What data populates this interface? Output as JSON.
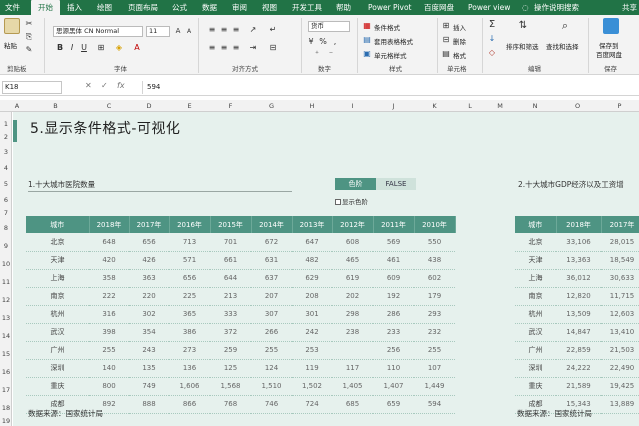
{
  "menu": {
    "tabs": [
      "文件",
      "开始",
      "插入",
      "绘图",
      "页面布局",
      "公式",
      "数据",
      "审阅",
      "视图",
      "开发工具",
      "帮助",
      "Power Pivot",
      "百度网盘",
      "Power view",
      "操作说明搜索",
      "共享"
    ]
  },
  "ribbon": {
    "clipboard": {
      "paste": "粘贴",
      "label": "剪贴板"
    },
    "font": {
      "name": "思源黑体 CN Normal",
      "size": "11",
      "label": "字体",
      "bold": "B",
      "italic": "I",
      "underline": "U",
      "grow": "A",
      "shrink": "A"
    },
    "align": {
      "label": "对齐方式"
    },
    "number": {
      "format": "货币",
      "label": "数字",
      "currency": "¥",
      "percent": "%",
      "comma": ","
    },
    "styles": {
      "cond": "条件格式",
      "table": "套用表格格式",
      "cell": "单元格样式",
      "label": "样式"
    },
    "cells": {
      "insert": "插入",
      "delete": "删除",
      "format": "格式",
      "label": "单元格"
    },
    "editing": {
      "sort": "排序和筛选",
      "find": "查找和选择",
      "label": "编辑"
    },
    "save": {
      "line1": "保存到",
      "line2": "百度网盘",
      "label": "保存"
    }
  },
  "formula": {
    "name": "K18",
    "fx": "fx",
    "value": "594"
  },
  "columns": [
    "A",
    "B",
    "C",
    "D",
    "E",
    "F",
    "G",
    "H",
    "I",
    "J",
    "K",
    "L",
    "M",
    "N",
    "O",
    "P"
  ],
  "rows": [
    "1",
    "2",
    "3",
    "4",
    "5",
    "6",
    "7",
    "8",
    "9",
    "10",
    "11",
    "12",
    "13",
    "14",
    "15",
    "16",
    "17",
    "18",
    "19"
  ],
  "sheet": {
    "title": "5.显示条件格式-可视化",
    "sub1": "1.十大城市医院数量",
    "sub2": "2.十大城市GDP经济以及工资增",
    "toggle_on": "色阶",
    "toggle_off": "FALSE",
    "checkbox": "显示色阶",
    "source1": "数据来源：国家统计局",
    "source2": "数据来源：国家统计局"
  },
  "table1": {
    "headers": [
      "城市",
      "2018年",
      "2017年",
      "2016年",
      "2015年",
      "2014年",
      "2013年",
      "2012年",
      "2011年",
      "2010年"
    ],
    "rows": [
      [
        "北京",
        "648",
        "656",
        "713",
        "701",
        "672",
        "647",
        "608",
        "569",
        "550"
      ],
      [
        "天津",
        "420",
        "426",
        "571",
        "661",
        "631",
        "482",
        "465",
        "461",
        "438"
      ],
      [
        "上海",
        "358",
        "363",
        "656",
        "644",
        "637",
        "629",
        "619",
        "609",
        "602"
      ],
      [
        "南京",
        "222",
        "220",
        "225",
        "213",
        "207",
        "208",
        "202",
        "192",
        "179"
      ],
      [
        "杭州",
        "316",
        "302",
        "365",
        "333",
        "307",
        "301",
        "298",
        "286",
        "293"
      ],
      [
        "武汉",
        "398",
        "354",
        "386",
        "372",
        "266",
        "242",
        "238",
        "233",
        "232"
      ],
      [
        "广州",
        "255",
        "243",
        "273",
        "259",
        "255",
        "253",
        "",
        "256",
        "255"
      ],
      [
        "深圳",
        "140",
        "135",
        "136",
        "125",
        "124",
        "119",
        "117",
        "110",
        "107"
      ],
      [
        "重庆",
        "800",
        "749",
        "1,606",
        "1,568",
        "1,510",
        "1,502",
        "1,405",
        "1,407",
        "1,449"
      ],
      [
        "成都",
        "892",
        "888",
        "866",
        "768",
        "746",
        "724",
        "685",
        "659",
        "594"
      ]
    ]
  },
  "table2": {
    "headers": [
      "城市",
      "2018年",
      "2017年"
    ],
    "rows": [
      [
        "北京",
        "33,106",
        "28,015"
      ],
      [
        "天津",
        "13,363",
        "18,549"
      ],
      [
        "上海",
        "36,012",
        "30,633"
      ],
      [
        "南京",
        "12,820",
        "11,715"
      ],
      [
        "杭州",
        "13,509",
        "12,603"
      ],
      [
        "武汉",
        "14,847",
        "13,410"
      ],
      [
        "广州",
        "22,859",
        "21,503"
      ],
      [
        "深圳",
        "24,222",
        "22,490"
      ],
      [
        "重庆",
        "21,589",
        "19,425"
      ],
      [
        "成都",
        "15,343",
        "13,889"
      ]
    ]
  }
}
